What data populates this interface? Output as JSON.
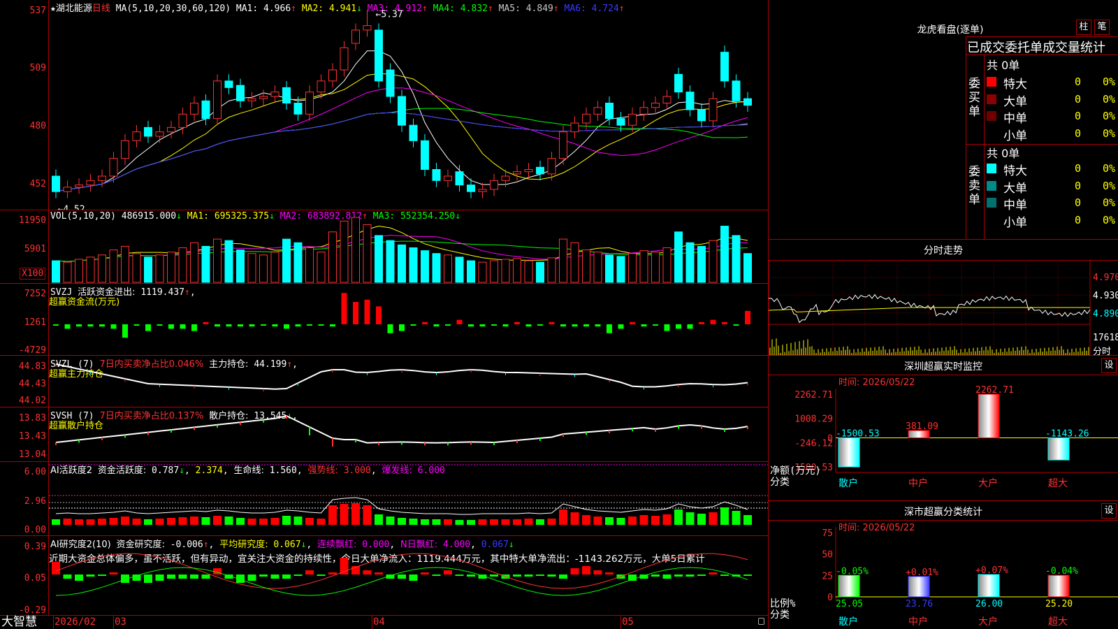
{
  "stock": {
    "name": "湖北能源",
    "period": "日线",
    "star": "★"
  },
  "main_pane": {
    "ma_label": "MA(5,10,20,30,60,120)",
    "ma": [
      {
        "label": "MA1:",
        "value": "4.966",
        "arrow": "↑",
        "color": "#ffffff"
      },
      {
        "label": "MA2:",
        "value": "4.941",
        "arrow": "↓",
        "color": "#ffff00"
      },
      {
        "label": "MA3:",
        "value": "4.912",
        "arrow": "↑",
        "color": "#ff00ff"
      },
      {
        "label": "MA4:",
        "value": "4.832",
        "arrow": "↑",
        "color": "#00ff00"
      },
      {
        "label": "MA5:",
        "value": "4.849",
        "arrow": "↑",
        "color": "#c8c8c8"
      },
      {
        "label": "MA6:",
        "value": "4.724",
        "arrow": "↑",
        "color": "#3a3aff"
      }
    ],
    "yticks": [
      "537",
      "509",
      "480",
      "452"
    ],
    "high_label": "5.37",
    "low_label": "4.52"
  },
  "vol_pane": {
    "label": "VOL(5,10,20)",
    "value": "486915.000",
    "value_arrow": "↓",
    "ma": [
      {
        "label": "MA1:",
        "value": "695325.375",
        "arrow": "↓",
        "color": "#ffff00"
      },
      {
        "label": "MA2:",
        "value": "683892.812",
        "arrow": "↑",
        "color": "#ff00ff"
      },
      {
        "label": "MA3:",
        "value": "552354.250",
        "arrow": "↓",
        "color": "#00ff00"
      }
    ],
    "yticks": [
      "11950",
      "5901"
    ],
    "unit": "X100"
  },
  "svzj_pane": {
    "label": "SVZJ",
    "desc": "活跃资金进出:",
    "value": "1119.437",
    "arrow": "↑",
    "comma": ",",
    "sub": "超赢资金流(万元)",
    "yticks": [
      "7252",
      "1261",
      "-4729"
    ]
  },
  "svzl_pane": {
    "label": "SVZL (7)",
    "desc": "7日内买卖净占比0.046%",
    "main": "主力持仓:",
    "value": "44.199",
    "arrow": "↑",
    "comma": ",",
    "sub": "超赢主力持仓",
    "yticks": [
      "44.83",
      "44.43",
      "44.02"
    ]
  },
  "svsh_pane": {
    "label": "SVSH (7)",
    "desc": "7日内买卖净占比0.137%",
    "main": "散户持仓:",
    "value": "13.545",
    "arrow": "↓",
    "comma": ",",
    "sub": "超赢散户持仓",
    "yticks": [
      "13.83",
      "13.43",
      "13.04"
    ]
  },
  "ai1_pane": {
    "label": "AI活跃度2",
    "desc": "资金活跃度:",
    "value": "0.787",
    "arrow": "↓",
    "v2": "2.374",
    "life": "生命线:",
    "life_v": "1.560",
    "strong": "强势线:",
    "strong_v": "3.000",
    "burst": "爆发线:",
    "burst_v": "6.000",
    "yticks": [
      "6.00",
      "2.96",
      "0.00"
    ]
  },
  "ai2_pane": {
    "label": "AI研究度2(10)",
    "desc": "资金研究度:",
    "value": "-0.006",
    "arrow": "↑",
    "avg": "平均研究度:",
    "avg_v": "0.067",
    "avg_arrow": "↓",
    "cont": "连续飘红:",
    "cont_v": "0.000",
    "nday": "N日飘红:",
    "nday_v": "4.000",
    "last": "0.067",
    "last_arrow": "↓",
    "comment": "近期大资金总体偏多，虽不活跃，但有异动，宜关注大资金的持续性，今日大单净流入：1119.444万元，其中特大单净流出：-1143.262万元，大单5日累计",
    "yticks": [
      "0.39",
      "0.05",
      "-0.29"
    ]
  },
  "footer": {
    "brand": "大智慧",
    "dates": [
      {
        "label": "2026/02"
      },
      {
        "label": "03"
      },
      {
        "label": "04"
      },
      {
        "label": "05"
      }
    ]
  },
  "longhu": {
    "title": "龙虎看盘(逐单)",
    "btn_col": "柱",
    "btn_bi": "笔",
    "subtitle": "已成交委托单成交量统计",
    "buy": {
      "side": "委买单",
      "total": "共 0单",
      "rows": [
        {
          "name": "特大",
          "count": "0",
          "pct": "0%",
          "color": "#ff0000"
        },
        {
          "name": "大单",
          "count": "0",
          "pct": "0%",
          "color": "#8b0000"
        },
        {
          "name": "中单",
          "count": "0",
          "pct": "0%",
          "color": "#700000"
        },
        {
          "name": "小单",
          "count": "0",
          "pct": "0%",
          "color": "#000000"
        }
      ]
    },
    "sell": {
      "side": "委卖单",
      "total": "共 0单",
      "rows": [
        {
          "name": "特大",
          "count": "0",
          "pct": "0%",
          "color": "#00ffff"
        },
        {
          "name": "大单",
          "count": "0",
          "pct": "0%",
          "color": "#008b8b"
        },
        {
          "name": "中单",
          "count": "0",
          "pct": "0%",
          "color": "#007070"
        },
        {
          "name": "小单",
          "count": "0",
          "pct": "0%",
          "color": "#000000"
        }
      ]
    }
  },
  "intraday": {
    "title": "分时走势",
    "p1": "4.970",
    "p2": "4.930",
    "p3": "4.890",
    "vol": "17618",
    "vol_unit": "分时"
  },
  "monitor": {
    "title": "深圳超赢实时监控",
    "settings": "设",
    "time": "时间: 2026/05/22",
    "yticks": [
      "2262.71",
      "1008.29",
      "-246.12",
      "-1500.53"
    ],
    "ylabel": "净额(万元)",
    "xlabel": "分类",
    "zero": "0",
    "categories": [
      "散户",
      "中户",
      "大户",
      "超大"
    ],
    "values": [
      -1500.53,
      381.09,
      2262.71,
      -1143.26
    ],
    "value_labels": [
      "-1500.53",
      "381.09",
      "2262.71",
      "-1143.26"
    ]
  },
  "classify": {
    "title": "深市超赢分类统计",
    "settings": "设",
    "time": "时间: 2026/05/22",
    "yticks": [
      "75",
      "50",
      "25",
      "0"
    ],
    "ylabel": "比例%",
    "xlabel": "分类",
    "categories": [
      "散户",
      "中户",
      "大户",
      "超大"
    ],
    "values": [
      25.05,
      23.76,
      26.0,
      25.2
    ],
    "value_labels": [
      "25.05",
      "23.76",
      "26.00",
      "25.20"
    ],
    "changes": [
      "-0.05%",
      "+0.01%",
      "+0.07%",
      "-0.04%"
    ]
  }
}
